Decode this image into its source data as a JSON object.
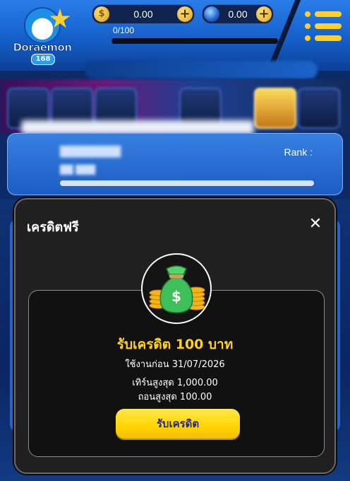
{
  "header": {
    "logo_text": "Doraemon",
    "logo_sub": "168",
    "coin_balance": "0.00",
    "gem_balance": "0.00",
    "progress_text": "0/100",
    "progress_fraction": 0.0
  },
  "profile": {
    "rank_label": "Rank :",
    "bar_fraction": 1.0
  },
  "modal": {
    "title": "เครดิตฟรี",
    "close_glyph": "✕",
    "credit_title": "รับเครดิต 100 บาท",
    "use_before": "ใช้งานก่อน 31/07/2026",
    "max_turnover": "เทิร์นสูงสุด 1,000.00",
    "max_withdraw": "ถอนสูงสุด 100.00",
    "claim_button": "รับเครดิต"
  },
  "icons": {
    "coin": "coin-icon",
    "gem": "gem-icon",
    "plus": "plus-icon",
    "menu": "hamburger-menu-icon",
    "close": "close-icon",
    "money_bag": "money-bag-icon"
  },
  "colors": {
    "accent_yellow": "#ffd21f",
    "modal_bg": "#202020",
    "app_blue": "#155fc9"
  }
}
